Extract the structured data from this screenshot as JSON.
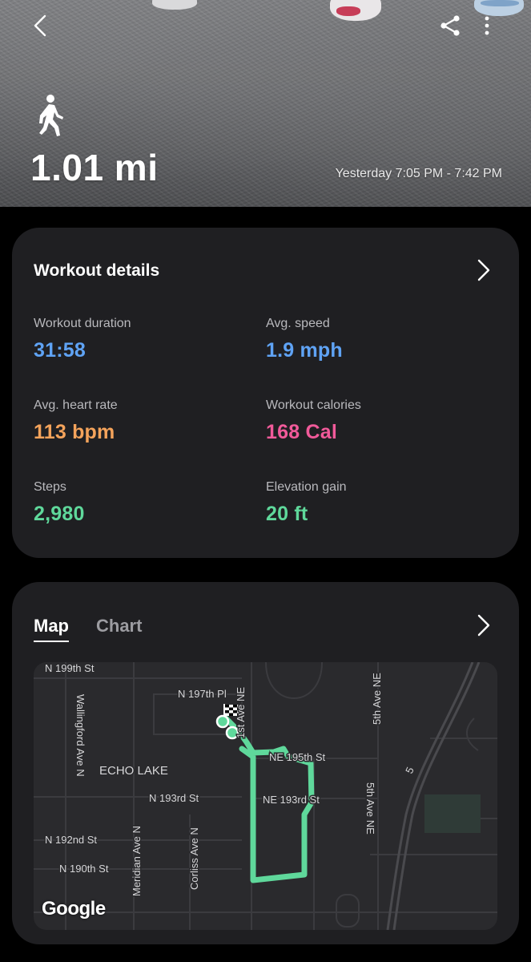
{
  "hero": {
    "activity_icon": "walk-icon",
    "distance": "1.01 mi",
    "time_range": "Yesterday 7:05 PM - 7:42 PM"
  },
  "workout_details": {
    "title": "Workout details",
    "stats": [
      {
        "label": "Workout duration",
        "value": "31:58",
        "color": "#5fa3f5"
      },
      {
        "label": "Avg. speed",
        "value": "1.9 mph",
        "color": "#5fa3f5"
      },
      {
        "label": "Avg. heart rate",
        "value": "113 bpm",
        "color": "#f4a35b"
      },
      {
        "label": "Workout calories",
        "value": "168 Cal",
        "color": "#f15a9a"
      },
      {
        "label": "Steps",
        "value": "2,980",
        "color": "#5fd89b"
      },
      {
        "label": "Elevation gain",
        "value": "20 ft",
        "color": "#5fd89b"
      }
    ]
  },
  "map_section": {
    "tabs": [
      {
        "label": "Map",
        "selected": true
      },
      {
        "label": "Chart",
        "selected": false
      }
    ],
    "route_color": "#5fd89b",
    "labels": {
      "n199": "N 199th St",
      "n197": "N 197th Pl",
      "first_ave": "1st Ave NE",
      "fifth_ave": "5th Ave NE",
      "fifth_ave2": "5th Ave NE",
      "wallingford": "Wallingford Ave N",
      "echo_lake": "ECHO LAKE",
      "ne195": "NE 195th St",
      "n193": "N 193rd St",
      "ne193": "NE 193rd St",
      "n192": "N 192nd St",
      "n190": "N 190th St",
      "meridian": "Meridian Ave N",
      "corliss": "Corliss Ave N",
      "hwy": "5"
    },
    "attribution": "Google"
  }
}
